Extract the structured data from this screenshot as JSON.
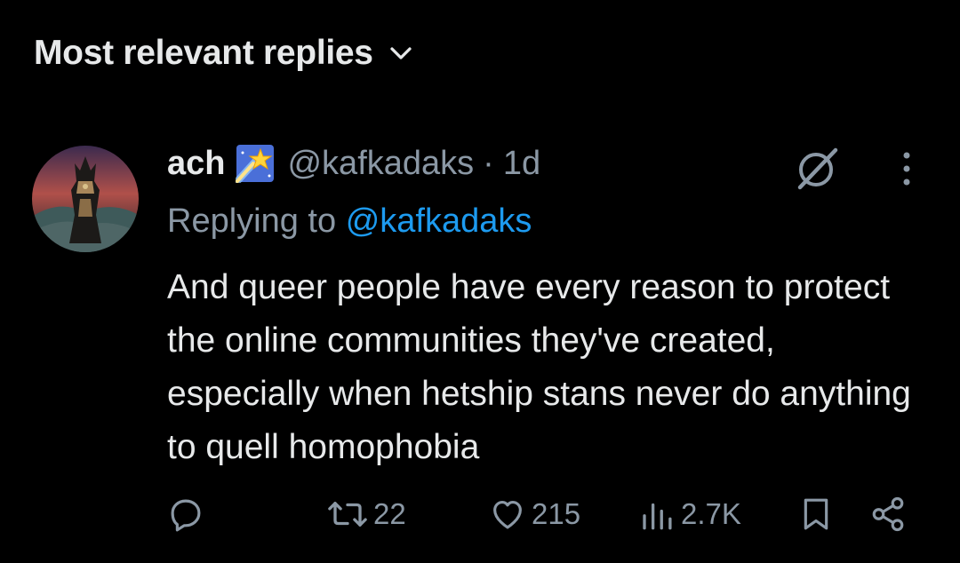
{
  "header": {
    "sort_label": "Most relevant replies",
    "chevron_icon": "chevron-down-icon"
  },
  "tweet": {
    "display_name": "ach",
    "badge_icon": "shooting-star-emoji",
    "handle": "@kafkadaks",
    "separator": "·",
    "time": "1d",
    "replying_prefix": "Replying to",
    "replying_handle": "@kafkadaks",
    "text": "And queer people have every reason to protect the online communities they've created, especially when hetship stans never do anything to quell homophobia",
    "grok_icon": "grok-icon",
    "more_icon": "more-vertical-icon"
  },
  "actions": {
    "reply": {
      "icon": "reply-icon",
      "count": ""
    },
    "repost": {
      "icon": "repost-icon",
      "count": "22"
    },
    "like": {
      "icon": "heart-icon",
      "count": "215"
    },
    "views": {
      "icon": "views-icon",
      "count": "2.7K"
    },
    "bookmark": {
      "icon": "bookmark-icon"
    },
    "share": {
      "icon": "share-icon"
    }
  },
  "colors": {
    "background": "#000000",
    "text": "#e7e9ea",
    "muted": "#8b98a5",
    "accent": "#1d9bf0"
  }
}
